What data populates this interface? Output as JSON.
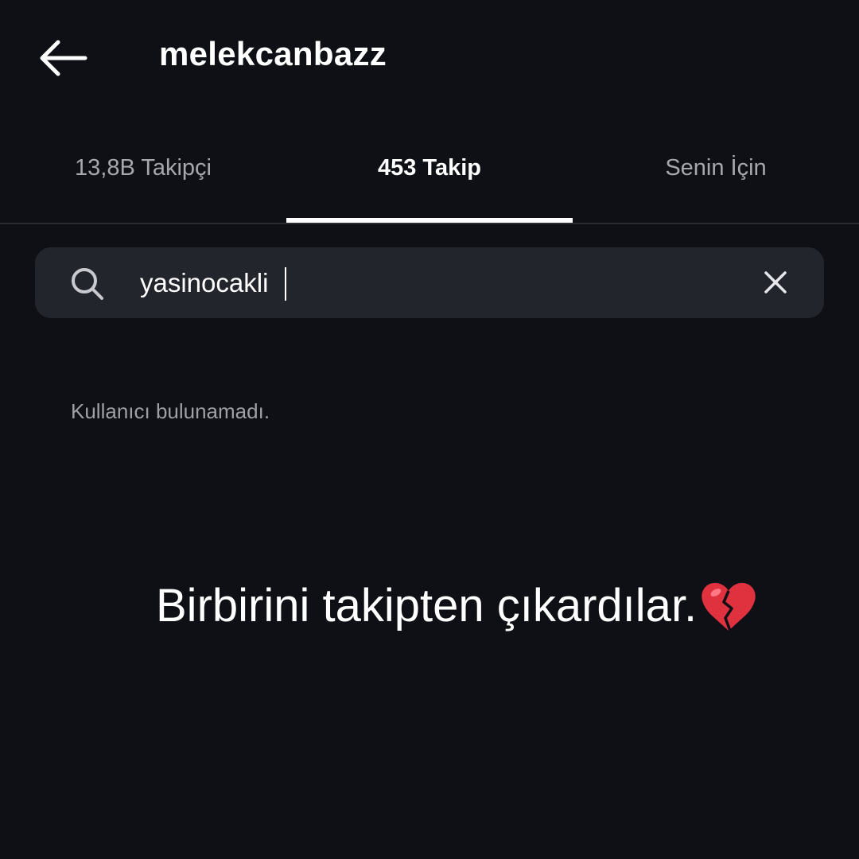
{
  "header": {
    "back_icon": "arrow-left-icon",
    "username": "melekcanbazz"
  },
  "tabs": [
    {
      "label": "13,8B Takipçi",
      "active": false
    },
    {
      "label": "453 Takip",
      "active": true
    },
    {
      "label": "Senin İçin",
      "active": false
    }
  ],
  "search": {
    "icon": "search-icon",
    "value": "yasinocakli",
    "clear_icon": "close-icon"
  },
  "results": {
    "empty_message": "Kullanıcı bulunamadı."
  },
  "overlay": {
    "caption": "Birbirini takipten çıkardılar.",
    "emoji": "broken-heart-icon"
  },
  "colors": {
    "background": "#0e1016",
    "search_bg": "#23252c",
    "heart": "#e0313f"
  }
}
